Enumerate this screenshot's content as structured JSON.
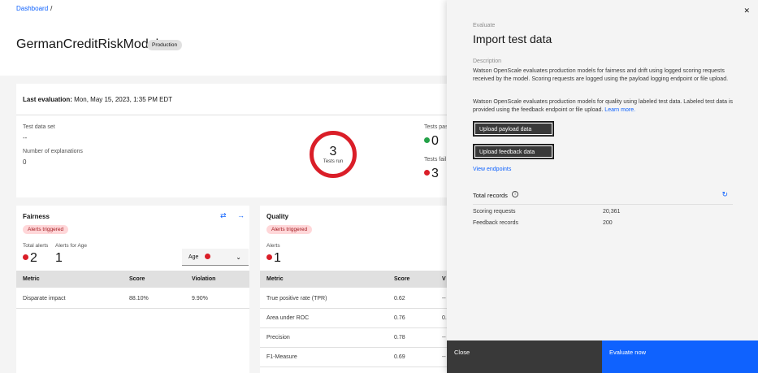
{
  "breadcrumb": {
    "link": "Dashboard",
    "separator": "/"
  },
  "model": {
    "name": "GermanCreditRiskModel",
    "tag": "Production"
  },
  "evaluation": {
    "label": "Last evaluation:",
    "value": "Mon, May 15, 2023, 1:35 PM EDT",
    "test_data_set_label": "Test data set",
    "test_data_set_value": "--",
    "explanations_label": "Number of explanations",
    "explanations_value": "0",
    "tests_run_value": "3",
    "tests_run_label": "Tests run",
    "tests_passed_label": "Tests pas",
    "tests_passed_value": "0",
    "tests_failed_label": "Tests fail",
    "tests_failed_value": "3"
  },
  "fairness": {
    "title": "Fairness",
    "tag": "Alerts triggered",
    "total_alerts_label": "Total alerts",
    "total_alerts_value": "2",
    "alerts_for_label": "Alerts for Age",
    "alerts_for_value": "1",
    "select_value": "Age",
    "columns": [
      "Metric",
      "Score",
      "Violation"
    ],
    "rows": [
      {
        "metric": "Disparate impact",
        "score": "88.10%",
        "violation": "9.90%"
      }
    ]
  },
  "quality": {
    "title": "Quality",
    "tag": "Alerts triggered",
    "alerts_label": "Alerts",
    "alerts_value": "1",
    "columns": [
      "Metric",
      "Score",
      "V"
    ],
    "rows": [
      {
        "metric": "True positive rate (TPR)",
        "score": "0.62",
        "violation": "--"
      },
      {
        "metric": "Area under ROC",
        "score": "0.76",
        "violation": "0."
      },
      {
        "metric": "Precision",
        "score": "0.78",
        "violation": "--"
      },
      {
        "metric": "F1-Measure",
        "score": "0.69",
        "violation": "--"
      }
    ]
  },
  "side_panel": {
    "eyebrow": "Evaluate",
    "title": "Import test data",
    "description_label": "Description",
    "para1": "Watson OpenScale evaluates production models for fairness and drift using logged scoring requests received by the model. Scoring requests are logged using the payload logging endpoint or file upload.",
    "para2": "Watson OpenScale evaluates production models for quality using labeled test data. Labeled test data is provided using the feedback endpoint or file upload.",
    "learn_more": "Learn more.",
    "upload_payload": "Upload payload data",
    "upload_feedback": "Upload feedback data",
    "view_endpoints": "View endpoints",
    "total_records_label": "Total records",
    "scoring_label": "Scoring requests",
    "scoring_value": "20,361",
    "feedback_label": "Feedback records",
    "feedback_value": "200",
    "close_label": "Close",
    "evaluate_label": "Evaluate now"
  },
  "icons": {
    "close": "close-icon",
    "info": "info-icon",
    "refresh": "refresh-icon",
    "chevron": "chevron-down-icon",
    "swap": "swap-icon",
    "arrow": "arrow-right-icon"
  },
  "colors": {
    "accent": "#0f62fe",
    "alert_red": "#da1e28",
    "success_green": "#24a148",
    "dark_button": "#393939"
  }
}
